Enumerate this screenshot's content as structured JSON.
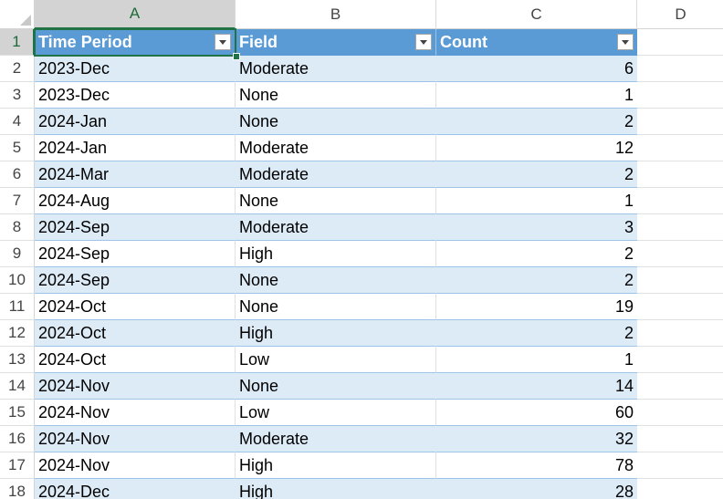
{
  "columns": [
    {
      "letter": "A",
      "width": 220,
      "selected": true
    },
    {
      "letter": "B",
      "width": 220,
      "selected": false
    },
    {
      "letter": "C",
      "width": 220,
      "selected": false
    },
    {
      "letter": "D",
      "width": 96,
      "selected": false
    }
  ],
  "table": {
    "headers": [
      "Time Period",
      "Field",
      "Count"
    ],
    "rows": [
      [
        "2023-Dec",
        "Moderate",
        "6"
      ],
      [
        "2023-Dec",
        "None",
        "1"
      ],
      [
        "2024-Jan",
        "None",
        "2"
      ],
      [
        "2024-Jan",
        "Moderate",
        "12"
      ],
      [
        "2024-Mar",
        "Moderate",
        "2"
      ],
      [
        "2024-Aug",
        "None",
        "1"
      ],
      [
        "2024-Sep",
        "Moderate",
        "3"
      ],
      [
        "2024-Sep",
        "High",
        "2"
      ],
      [
        "2024-Sep",
        "None",
        "2"
      ],
      [
        "2024-Oct",
        "None",
        "19"
      ],
      [
        "2024-Oct",
        "High",
        "2"
      ],
      [
        "2024-Oct",
        "Low",
        "1"
      ],
      [
        "2024-Nov",
        "None",
        "14"
      ],
      [
        "2024-Nov",
        "Low",
        "60"
      ],
      [
        "2024-Nov",
        "Moderate",
        "32"
      ],
      [
        "2024-Nov",
        "High",
        "78"
      ],
      [
        "2024-Dec",
        "High",
        "28"
      ]
    ]
  },
  "row_numbers": [
    "1",
    "2",
    "3",
    "4",
    "5",
    "6",
    "7",
    "8",
    "9",
    "10",
    "11",
    "12",
    "13",
    "14",
    "15",
    "16",
    "17",
    "18"
  ],
  "colors": {
    "header_fill": "#5b9bd5",
    "band_fill": "#ddebf7",
    "selection": "#217346"
  },
  "icons": {
    "filter_dropdown": "chevron-down-icon",
    "select_all": "select-all-triangle-icon"
  }
}
